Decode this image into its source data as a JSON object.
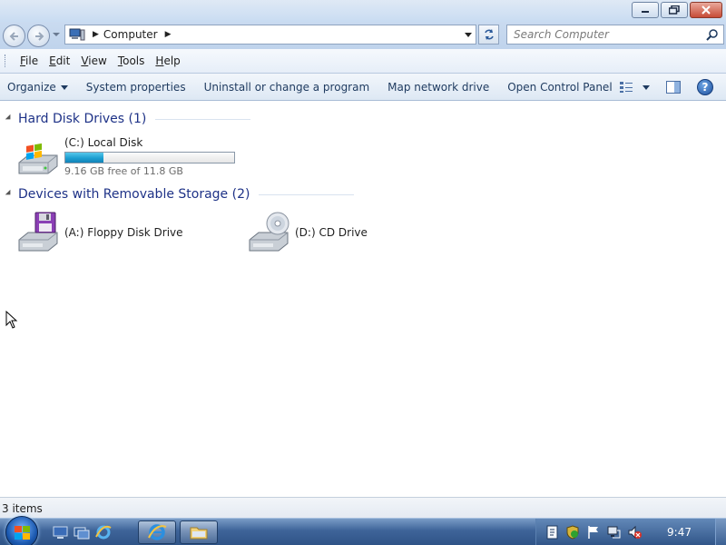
{
  "window": {
    "title_buttons": [
      "minimize",
      "maximize",
      "close"
    ]
  },
  "address": {
    "location_icon": "computer-icon",
    "crumb": "Computer",
    "search_placeholder": "Search Computer"
  },
  "menu": {
    "items": [
      "File",
      "Edit",
      "View",
      "Tools",
      "Help"
    ]
  },
  "commands": {
    "organize": "Organize",
    "system_properties": "System properties",
    "uninstall": "Uninstall or change a program",
    "map_drive": "Map network drive",
    "control_panel": "Open Control Panel"
  },
  "groups": {
    "hard_disks": {
      "title": "Hard Disk Drives (1)",
      "drives": [
        {
          "name": "(C:) Local Disk",
          "free_text": "9.16 GB free of 11.8 GB",
          "used_fraction": 0.224,
          "icon": "hard-disk-windows-icon"
        }
      ]
    },
    "removable": {
      "title": "Devices with Removable Storage (2)",
      "drives": [
        {
          "name": "(A:) Floppy Disk Drive",
          "icon": "floppy-drive-icon"
        },
        {
          "name": "(D:) CD Drive",
          "icon": "cd-drive-icon"
        }
      ]
    }
  },
  "status": {
    "items_text": "3 items"
  },
  "taskbar": {
    "clock": "9:47",
    "quick_launch": [
      "show-desktop-icon",
      "switch-windows-icon",
      "internet-explorer-icon"
    ],
    "open_windows": [
      "internet-explorer-icon",
      "windows-explorer-icon"
    ],
    "tray": [
      "action-center-icon",
      "security-shield-icon",
      "flag-icon",
      "network-icon",
      "volume-muted-icon"
    ]
  },
  "colors": {
    "group_title": "#1e3287",
    "capacity_fill": "#1d9fd1",
    "taskbar": "#2f5487"
  }
}
